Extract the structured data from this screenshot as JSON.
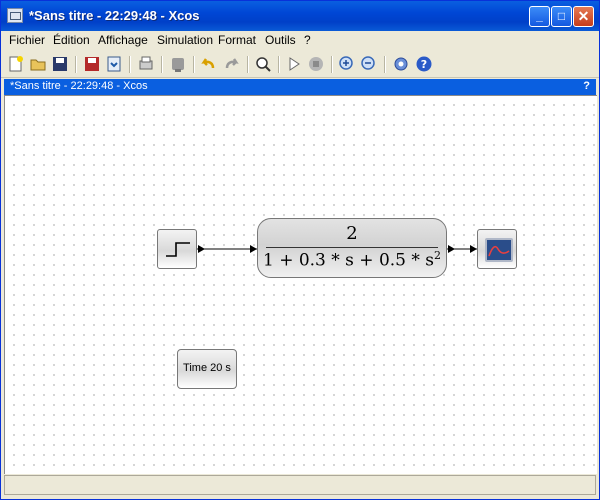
{
  "window": {
    "title": "*Sans titre - 22:29:48 - Xcos",
    "min_label": "_",
    "max_label": "□",
    "close_label": "✕"
  },
  "menu": {
    "items": [
      "Fichier",
      "Édition",
      "Affichage",
      "Simulation",
      "Format",
      "Outils",
      "?"
    ]
  },
  "toolbar": {
    "icons": [
      "new-icon",
      "open-icon",
      "save-icon",
      "save-as-icon",
      "print-icon",
      "export-icon",
      "compile-icon",
      "undo-icon",
      "redo-icon",
      "fit-view-icon",
      "start-icon",
      "stop-icon",
      "zoom-in-icon",
      "zoom-out-icon",
      "setup-icon",
      "help-icon"
    ]
  },
  "diagram": {
    "title": "*Sans titre - 22:29:48 - Xcos",
    "help_label": "?",
    "clr_numerator": "2",
    "clr_denominator_prefix": "1 + 0.3 * s + 0.5 * s",
    "clr_denominator_power": "2",
    "time_label": "Time 20 s"
  },
  "colors": {
    "titlebar": "#0a5fe0",
    "scope_screen": "#2a4d8a",
    "scope_curve": "#e84040"
  }
}
